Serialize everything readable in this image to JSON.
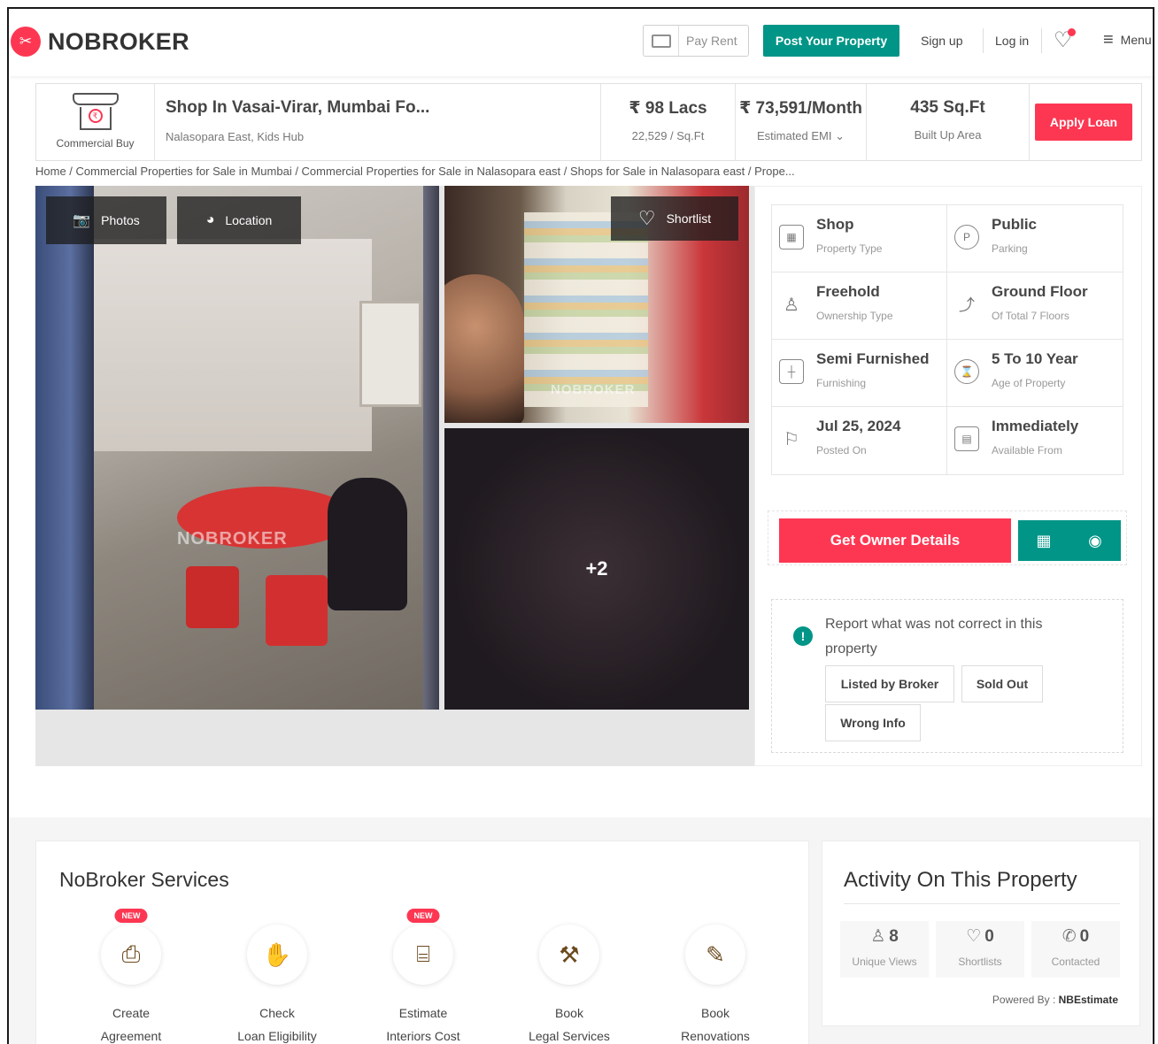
{
  "header": {
    "logo_text": "NOBROKER",
    "pay_rent": "Pay Rent",
    "post_property": "Post Your Property",
    "sign_up": "Sign up",
    "log_in": "Log in",
    "menu": "Menu"
  },
  "summary": {
    "category": "Commercial Buy",
    "title": "Shop In Vasai-Virar, Mumbai Fo...",
    "subtitle": "Nalasopara East, Kids Hub",
    "price": "₹ 98 Lacs",
    "price_per_sqft": "22,529 / Sq.Ft",
    "emi": "₹ 73,591/Month",
    "emi_label": "Estimated EMI",
    "area": "435 Sq.Ft",
    "area_label": "Built Up Area",
    "apply_loan": "Apply Loan"
  },
  "breadcrumb": "Home / Commercial Properties for Sale in Mumbai / Commercial Properties for Sale in Nalasopara east / Shops for Sale in Nalasopara east / Prope...",
  "gallery": {
    "photos": "Photos",
    "location": "Location",
    "shortlist": "Shortlist",
    "more_photos": "+2",
    "watermark": "NOBROKER"
  },
  "attributes": [
    {
      "value": "Shop",
      "label": "Property Type",
      "icon": "building-icon"
    },
    {
      "value": "Public",
      "label": "Parking",
      "icon": "parking-icon"
    },
    {
      "value": "Freehold",
      "label": "Ownership Type",
      "icon": "owner-icon"
    },
    {
      "value": "Ground Floor",
      "label": "Of Total 7 Floors",
      "icon": "stairs-icon"
    },
    {
      "value": "Semi Furnished",
      "label": "Furnishing",
      "icon": "furniture-icon"
    },
    {
      "value": "5 To 10 Year",
      "label": "Age of Property",
      "icon": "hourglass-icon"
    },
    {
      "value": "Jul 25, 2024",
      "label": "Posted On",
      "icon": "flag-icon"
    },
    {
      "value": "Immediately",
      "label": "Available From",
      "icon": "calendar-icon"
    }
  ],
  "owner": {
    "get_owner_details": "Get Owner Details"
  },
  "report": {
    "text": "Report what was not correct in this property",
    "listed_by_broker": "Listed by Broker",
    "sold_out": "Sold Out",
    "wrong_info": "Wrong Info"
  },
  "services": {
    "title": "NoBroker Services",
    "new_badge": "NEW",
    "items": [
      {
        "line1": "Create",
        "line2": "Agreement",
        "new": true,
        "icon": "agreement-stamp-icon"
      },
      {
        "line1": "Check",
        "line2": "Loan Eligibility",
        "new": false,
        "icon": "loan-hand-icon"
      },
      {
        "line1": "Estimate",
        "line2": "Interiors Cost",
        "new": true,
        "icon": "interiors-lamp-icon"
      },
      {
        "line1": "Book",
        "line2": "Legal Services",
        "new": false,
        "icon": "gavel-icon"
      },
      {
        "line1": "Book",
        "line2": "Renovations",
        "new": false,
        "icon": "paint-icon"
      }
    ]
  },
  "activity": {
    "title": "Activity On This Property",
    "unique_views": "8",
    "unique_views_label": "Unique Views",
    "shortlists": "0",
    "shortlists_label": "Shortlists",
    "contacted": "0",
    "contacted_label": "Contacted",
    "powered_by_label": "Powered By :",
    "powered_by": "NBEstimate"
  },
  "colors": {
    "brand_red": "#fd3752",
    "brand_teal": "#009587"
  }
}
